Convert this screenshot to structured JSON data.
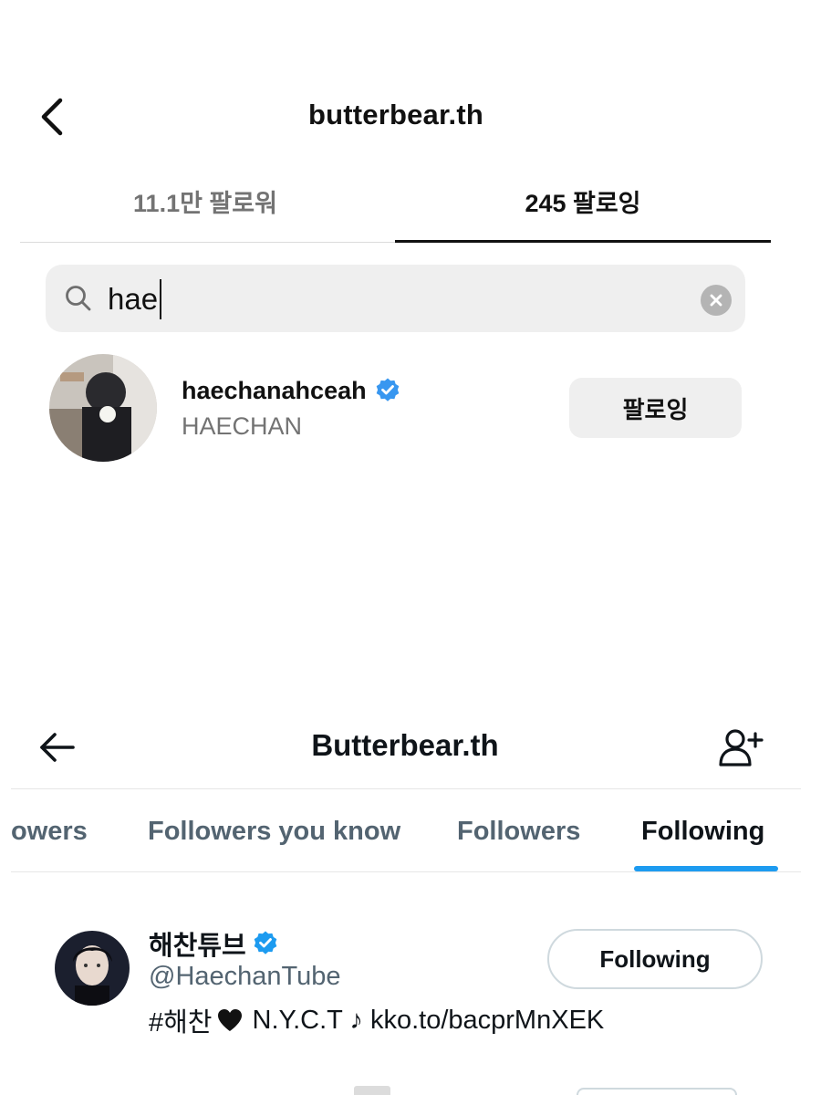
{
  "instagram": {
    "header": {
      "title": "butterbear.th"
    },
    "tabs": [
      {
        "label": "11.1만 팔로워",
        "active": false
      },
      {
        "label": "245 팔로잉",
        "active": true
      }
    ],
    "search": {
      "value": "hae"
    },
    "result": {
      "username": "haechanahceah",
      "full_name": "HAECHAN",
      "verified": true,
      "button_label": "팔로잉"
    }
  },
  "x": {
    "header": {
      "title": "Butterbear.th"
    },
    "tabs": [
      {
        "label": "owers",
        "active": false
      },
      {
        "label": "Followers you know",
        "active": false
      },
      {
        "label": "Followers",
        "active": false
      },
      {
        "label": "Following",
        "active": true
      }
    ],
    "user": {
      "name": "해찬튜브",
      "handle": "@HaechanTube",
      "verified": true,
      "bio_prefix": "#해찬",
      "bio_suffix": "N.Y.C.T ♪ kko.to/bacprMnXEK",
      "button_label": "Following"
    }
  },
  "colors": {
    "verified_blue": "#3897f0",
    "x_accent": "#1d9bf0",
    "muted_text": "#737373"
  }
}
